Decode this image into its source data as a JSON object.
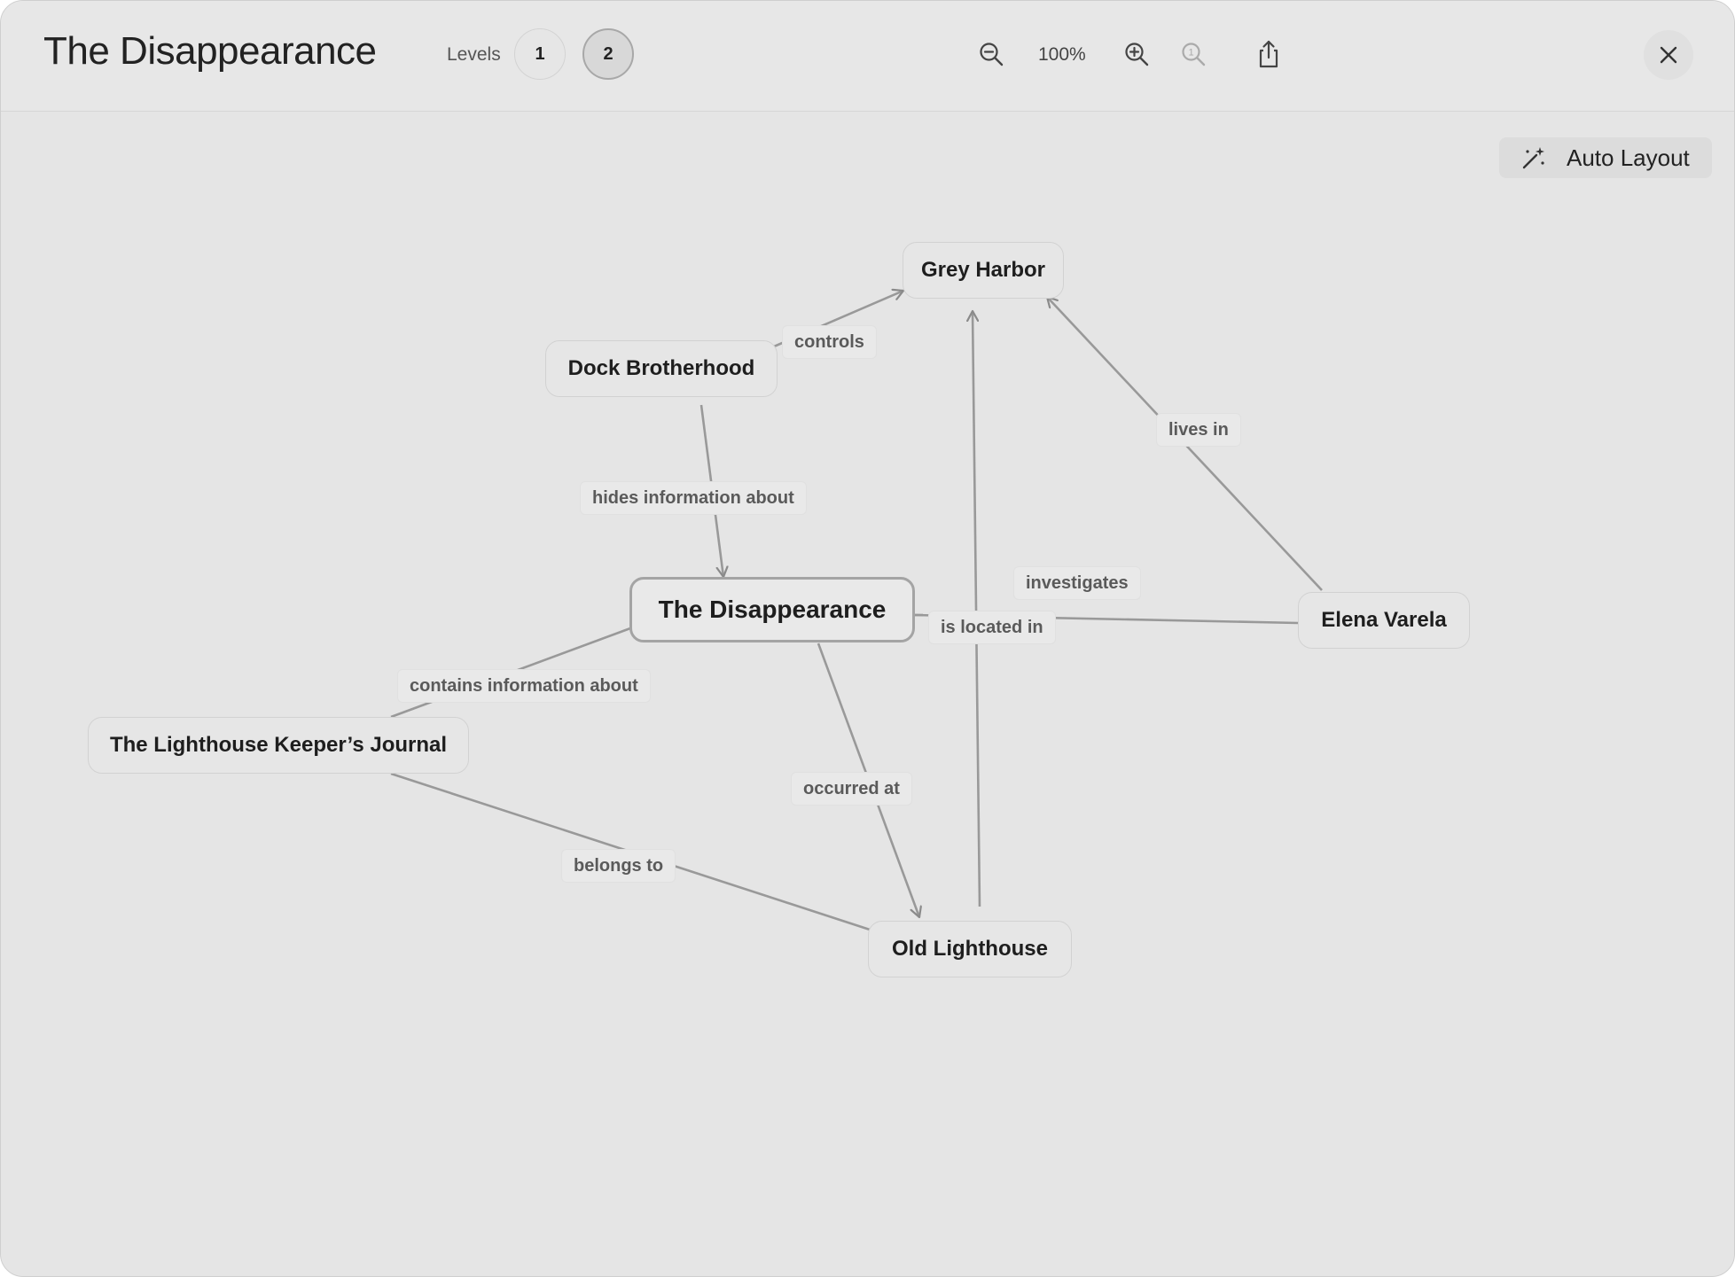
{
  "window": {
    "title": "The Disappearance"
  },
  "toolbar": {
    "levels_label": "Levels",
    "levels": [
      "1",
      "2"
    ],
    "active_level": "2",
    "zoom": "100%",
    "icons": [
      "zoom-out-icon",
      "zoom-in-icon",
      "zoom-reset-icon",
      "share-icon",
      "close-icon"
    ]
  },
  "auto_layout": {
    "label": "Auto Layout",
    "icon": "magic-wand-icon"
  },
  "graph": {
    "nodes": {
      "grey_harbor": "Grey Harbor",
      "dock_brotherhood": "Dock Brotherhood",
      "the_disappearance": "The Disappearance",
      "elena_varela": "Elena Varela",
      "lighthouse_journal": "The Lighthouse Keeper’s Journal",
      "old_lighthouse": "Old Lighthouse"
    },
    "edges": {
      "controls": "controls",
      "lives_in": "lives in",
      "hides_information_about": "hides information about",
      "investigates": "investigates",
      "is_located_in": "is located in",
      "contains_information_about": "contains information about",
      "occurred_at": "occurred at",
      "belongs_to": "belongs to"
    }
  }
}
